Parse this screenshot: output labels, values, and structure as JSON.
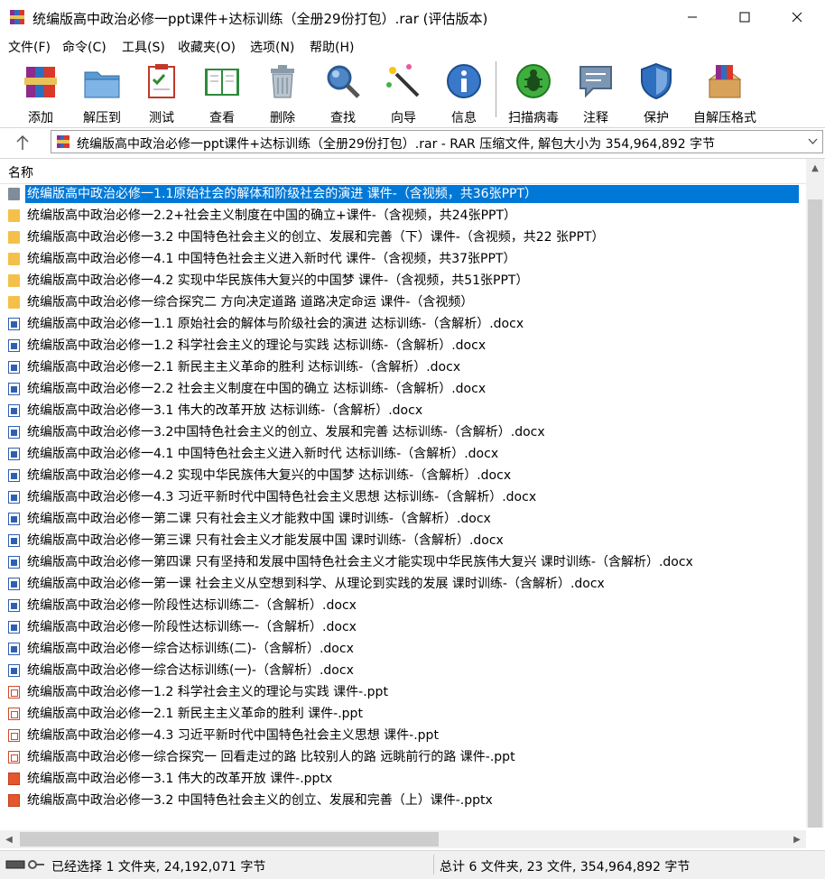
{
  "window": {
    "title": "统编版高中政治必修一ppt课件+达标训练（全册29份打包）.rar (评估版本)",
    "controls": [
      "minimize-icon",
      "maximize-icon",
      "close-icon"
    ]
  },
  "menu": [
    "文件(F)",
    "命令(C)",
    "工具(S)",
    "收藏夹(O)",
    "选项(N)",
    "帮助(H)"
  ],
  "toolbar": [
    {
      "label": "添加",
      "icon": "books-add-icon"
    },
    {
      "label": "解压到",
      "icon": "folder-extract-icon"
    },
    {
      "label": "测试",
      "icon": "clipboard-check-icon"
    },
    {
      "label": "查看",
      "icon": "open-book-icon"
    },
    {
      "label": "删除",
      "icon": "trash-icon"
    },
    {
      "label": "查找",
      "icon": "magnifier-icon"
    },
    {
      "label": "向导",
      "icon": "magic-wand-icon"
    },
    {
      "label": "信息",
      "icon": "info-icon"
    },
    {
      "label": "扫描病毒",
      "icon": "bug-scan-icon"
    },
    {
      "label": "注释",
      "icon": "comment-icon"
    },
    {
      "label": "保护",
      "icon": "shield-icon"
    },
    {
      "label": "自解压格式",
      "icon": "sfx-box-icon"
    }
  ],
  "address": {
    "path": "统编版高中政治必修一ppt课件+达标训练（全册29份打包）.rar - RAR 压缩文件, 解包大小为 354,964,892 字节"
  },
  "list": {
    "column_name": "名称",
    "rows": [
      {
        "name": "统编版高中政治必修一1.1原始社会的解体和阶级社会的演进 课件-（含视频，共36张PPT）",
        "type": "folder",
        "selected": true
      },
      {
        "name": "统编版高中政治必修一2.2+社会主义制度在中国的确立+课件-（含视频，共24张PPT）",
        "type": "folder"
      },
      {
        "name": "统编版高中政治必修一3.2 中国特色社会主义的创立、发展和完善（下）课件-（含视频，共22 张PPT）",
        "type": "folder"
      },
      {
        "name": "统编版高中政治必修一4.1 中国特色社会主义进入新时代 课件-（含视频，共37张PPT）",
        "type": "folder"
      },
      {
        "name": "统编版高中政治必修一4.2 实现中华民族伟大复兴的中国梦 课件-（含视频，共51张PPT）",
        "type": "folder"
      },
      {
        "name": "统编版高中政治必修一综合探究二 方向决定道路 道路决定命运 课件-（含视频）",
        "type": "folder"
      },
      {
        "name": "统编版高中政治必修一1.1 原始社会的解体与阶级社会的演进 达标训练-（含解析）.docx",
        "type": "docx"
      },
      {
        "name": "统编版高中政治必修一1.2 科学社会主义的理论与实践 达标训练-（含解析）.docx",
        "type": "docx"
      },
      {
        "name": "统编版高中政治必修一2.1 新民主主义革命的胜利 达标训练-（含解析）.docx",
        "type": "docx"
      },
      {
        "name": "统编版高中政治必修一2.2 社会主义制度在中国的确立 达标训练-（含解析）.docx",
        "type": "docx"
      },
      {
        "name": "统编版高中政治必修一3.1 伟大的改革开放 达标训练-（含解析）.docx",
        "type": "docx"
      },
      {
        "name": "统编版高中政治必修一3.2中国特色社会主义的创立、发展和完善 达标训练-（含解析）.docx",
        "type": "docx"
      },
      {
        "name": "统编版高中政治必修一4.1 中国特色社会主义进入新时代 达标训练-（含解析）.docx",
        "type": "docx"
      },
      {
        "name": "统编版高中政治必修一4.2 实现中华民族伟大复兴的中国梦 达标训练-（含解析）.docx",
        "type": "docx"
      },
      {
        "name": "统编版高中政治必修一4.3 习近平新时代中国特色社会主义思想 达标训练-（含解析）.docx",
        "type": "docx"
      },
      {
        "name": "统编版高中政治必修一第二课 只有社会主义才能救中国 课时训练-（含解析）.docx",
        "type": "docx"
      },
      {
        "name": "统编版高中政治必修一第三课 只有社会主义才能发展中国 课时训练-（含解析）.docx",
        "type": "docx"
      },
      {
        "name": "统编版高中政治必修一第四课 只有坚持和发展中国特色社会主义才能实现中华民族伟大复兴 课时训练-（含解析）.docx",
        "type": "docx"
      },
      {
        "name": "统编版高中政治必修一第一课 社会主义从空想到科学、从理论到实践的发展 课时训练-（含解析）.docx",
        "type": "docx"
      },
      {
        "name": "统编版高中政治必修一阶段性达标训练二-（含解析）.docx",
        "type": "docx"
      },
      {
        "name": "统编版高中政治必修一阶段性达标训练一-（含解析）.docx",
        "type": "docx"
      },
      {
        "name": "统编版高中政治必修一综合达标训练(二)-（含解析）.docx",
        "type": "docx"
      },
      {
        "name": "统编版高中政治必修一综合达标训练(一)-（含解析）.docx",
        "type": "docx"
      },
      {
        "name": "统编版高中政治必修一1.2 科学社会主义的理论与实践 课件-.ppt",
        "type": "ppt"
      },
      {
        "name": "统编版高中政治必修一2.1 新民主主义革命的胜利 课件-.ppt",
        "type": "ppt"
      },
      {
        "name": "统编版高中政治必修一4.3 习近平新时代中国特色社会主义思想 课件-.ppt",
        "type": "ppt"
      },
      {
        "name": "统编版高中政治必修一综合探究一 回看走过的路 比较别人的路 远眺前行的路 课件-.ppt",
        "type": "ppt"
      },
      {
        "name": "统编版高中政治必修一3.1 伟大的改革开放 课件-.pptx",
        "type": "pptx"
      },
      {
        "name": "统编版高中政治必修一3.2 中国特色社会主义的创立、发展和完善（上）课件-.pptx",
        "type": "pptx"
      }
    ]
  },
  "status": {
    "left": "已经选择 1 文件夹, 24,192,071 字节",
    "right": "总计 6 文件夹, 23 文件, 354,964,892 字节"
  },
  "colors": {
    "selection": "#0078d7",
    "folder": "#f4c04a",
    "docx": "#2f5fb3",
    "ppt": "#d04a2b"
  }
}
